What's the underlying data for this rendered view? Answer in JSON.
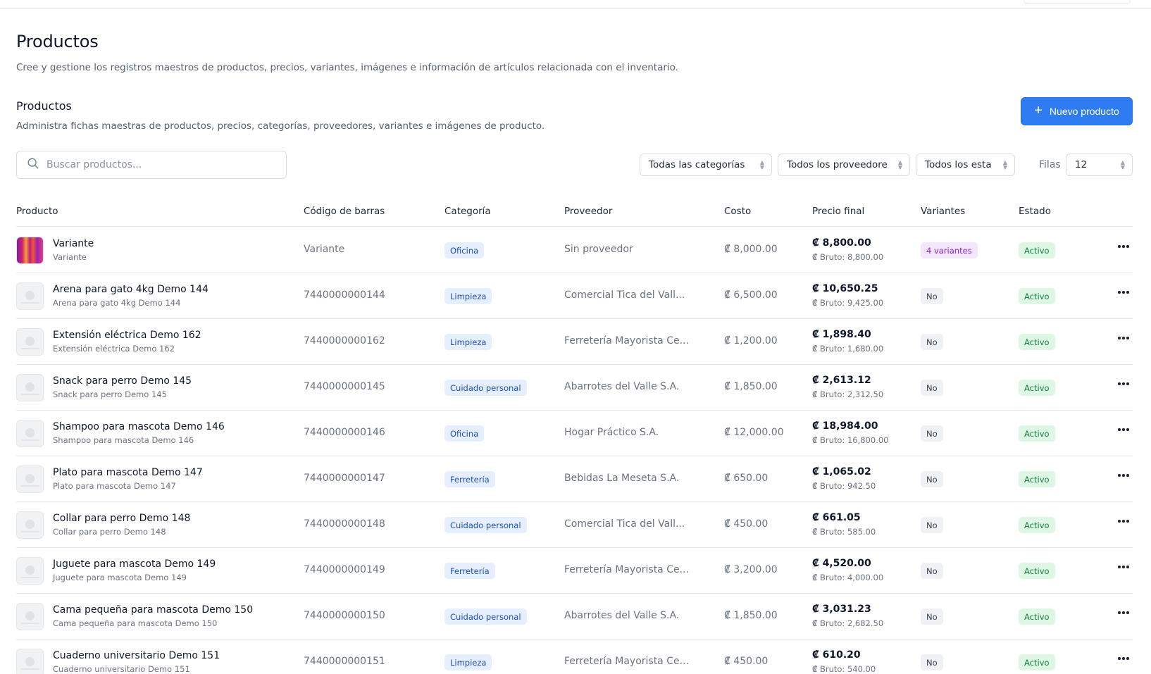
{
  "page": {
    "title": "Productos",
    "subtitle": "Cree y gestione los registros maestros de productos, precios, variantes, imágenes e información de artículos relacionada con el inventario."
  },
  "section": {
    "title": "Productos",
    "subtitle": "Administra fichas maestras de productos, precios, categorías, proveedores, variantes e imágenes de producto.",
    "new_button": "Nuevo producto"
  },
  "filters": {
    "search_placeholder": "Buscar productos...",
    "category": "Todas las categorías",
    "supplier": "Todos los proveedore",
    "status": "Todos los esta",
    "rows_label": "Filas",
    "rows_value": "12"
  },
  "table": {
    "headers": {
      "product": "Producto",
      "barcode": "Código de barras",
      "category": "Categoría",
      "supplier": "Proveedor",
      "cost": "Costo",
      "final_price": "Precio final",
      "variants": "Variantes",
      "status": "Estado"
    },
    "rows": [
      {
        "name": "Variante",
        "sub": "Variante",
        "barcode": "Variante",
        "category": "Oficina",
        "supplier": "Sin proveedor",
        "cost": "₡ 8,000.00",
        "price": "₡ 8,800.00",
        "bruto": "₡ Bruto: 8,800.00",
        "variants": "4 variantes",
        "status": "Activo"
      },
      {
        "name": "Arena para gato 4kg Demo 144",
        "sub": "Arena para gato 4kg Demo 144",
        "barcode": "7440000000144",
        "category": "Limpieza",
        "supplier": "Comercial Tica del Vall...",
        "cost": "₡ 6,500.00",
        "price": "₡ 10,650.25",
        "bruto": "₡ Bruto: 9,425.00",
        "variants": "No",
        "status": "Activo"
      },
      {
        "name": "Extensión eléctrica Demo 162",
        "sub": "Extensión eléctrica Demo 162",
        "barcode": "7440000000162",
        "category": "Limpieza",
        "supplier": "Ferretería Mayorista Ce...",
        "cost": "₡ 1,200.00",
        "price": "₡ 1,898.40",
        "bruto": "₡ Bruto: 1,680.00",
        "variants": "No",
        "status": "Activo"
      },
      {
        "name": "Snack para perro Demo 145",
        "sub": "Snack para perro Demo 145",
        "barcode": "7440000000145",
        "category": "Cuidado personal",
        "supplier": "Abarrotes del Valle S.A.",
        "cost": "₡ 1,850.00",
        "price": "₡ 2,613.12",
        "bruto": "₡ Bruto: 2,312.50",
        "variants": "No",
        "status": "Activo"
      },
      {
        "name": "Shampoo para mascota Demo 146",
        "sub": "Shampoo para mascota Demo 146",
        "barcode": "7440000000146",
        "category": "Oficina",
        "supplier": "Hogar Práctico S.A.",
        "cost": "₡ 12,000.00",
        "price": "₡ 18,984.00",
        "bruto": "₡ Bruto: 16,800.00",
        "variants": "No",
        "status": "Activo"
      },
      {
        "name": "Plato para mascota Demo 147",
        "sub": "Plato para mascota Demo 147",
        "barcode": "7440000000147",
        "category": "Ferretería",
        "supplier": "Bebidas La Meseta S.A.",
        "cost": "₡ 650.00",
        "price": "₡ 1,065.02",
        "bruto": "₡ Bruto: 942.50",
        "variants": "No",
        "status": "Activo"
      },
      {
        "name": "Collar para perro Demo 148",
        "sub": "Collar para perro Demo 148",
        "barcode": "7440000000148",
        "category": "Cuidado personal",
        "supplier": "Comercial Tica del Vall...",
        "cost": "₡ 450.00",
        "price": "₡ 661.05",
        "bruto": "₡ Bruto: 585.00",
        "variants": "No",
        "status": "Activo"
      },
      {
        "name": "Juguete para mascota Demo 149",
        "sub": "Juguete para mascota Demo 149",
        "barcode": "7440000000149",
        "category": "Ferretería",
        "supplier": "Ferretería Mayorista Ce...",
        "cost": "₡ 3,200.00",
        "price": "₡ 4,520.00",
        "bruto": "₡ Bruto: 4,000.00",
        "variants": "No",
        "status": "Activo"
      },
      {
        "name": "Cama pequeña para mascota Demo 150",
        "sub": "Cama pequeña para mascota Demo 150",
        "barcode": "7440000000150",
        "category": "Cuidado personal",
        "supplier": "Abarrotes del Valle S.A.",
        "cost": "₡ 1,850.00",
        "price": "₡ 3,031.23",
        "bruto": "₡ Bruto: 2,682.50",
        "variants": "No",
        "status": "Activo"
      },
      {
        "name": "Cuaderno universitario Demo 151",
        "sub": "Cuaderno universitario Demo 151",
        "barcode": "7440000000151",
        "category": "Limpieza",
        "supplier": "Ferretería Mayorista Ce...",
        "cost": "₡ 450.00",
        "price": "₡ 610.20",
        "bruto": "₡ Bruto: 540.00",
        "variants": "No",
        "status": "Activo"
      }
    ]
  }
}
